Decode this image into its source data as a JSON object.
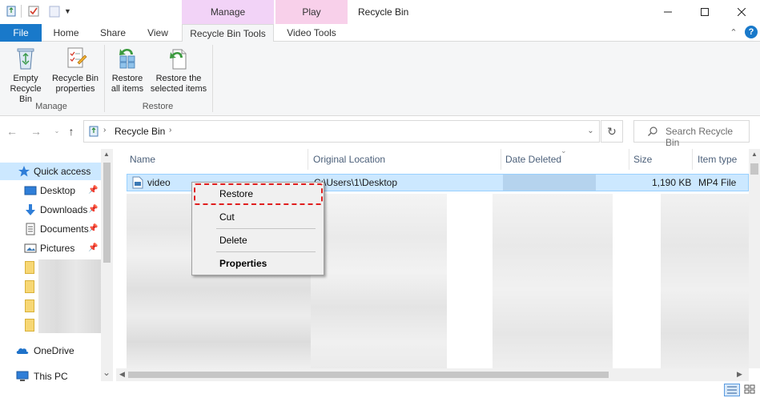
{
  "window": {
    "title": "Recycle Bin",
    "context_headers": {
      "manage": "Manage",
      "play": "Play"
    }
  },
  "tabs": {
    "file": "File",
    "home": "Home",
    "share": "Share",
    "view": "View",
    "recycle_bin_tools": "Recycle Bin Tools",
    "video_tools": "Video Tools"
  },
  "ribbon": {
    "manage_group": {
      "label": "Manage",
      "empty_recycle_bin": [
        "Empty",
        "Recycle Bin"
      ],
      "recycle_bin_properties": [
        "Recycle Bin",
        "properties"
      ]
    },
    "restore_group": {
      "label": "Restore",
      "restore_all": [
        "Restore",
        "all items"
      ],
      "restore_selected": [
        "Restore the",
        "selected items"
      ]
    }
  },
  "address": {
    "location": "Recycle Bin",
    "search_placeholder": "Search Recycle Bin"
  },
  "nav_pane": {
    "items": [
      {
        "label": "Quick access"
      },
      {
        "label": "Desktop"
      },
      {
        "label": "Downloads"
      },
      {
        "label": "Documents"
      },
      {
        "label": "Pictures"
      },
      {
        "label": "OneDrive"
      },
      {
        "label": "This PC"
      }
    ]
  },
  "columns": [
    "Name",
    "Original Location",
    "Date Deleted",
    "Size",
    "Item type"
  ],
  "selected_row": {
    "name": "video",
    "original_location": "C:\\Users\\1\\Desktop",
    "size": "1,190 KB",
    "item_type": "MP4 File"
  },
  "context_menu": {
    "restore": "Restore",
    "cut": "Cut",
    "delete": "Delete",
    "properties": "Properties"
  },
  "colors": {
    "accent": "#1979ca",
    "selection": "#cce8ff",
    "highlight": "#e01e1e"
  }
}
